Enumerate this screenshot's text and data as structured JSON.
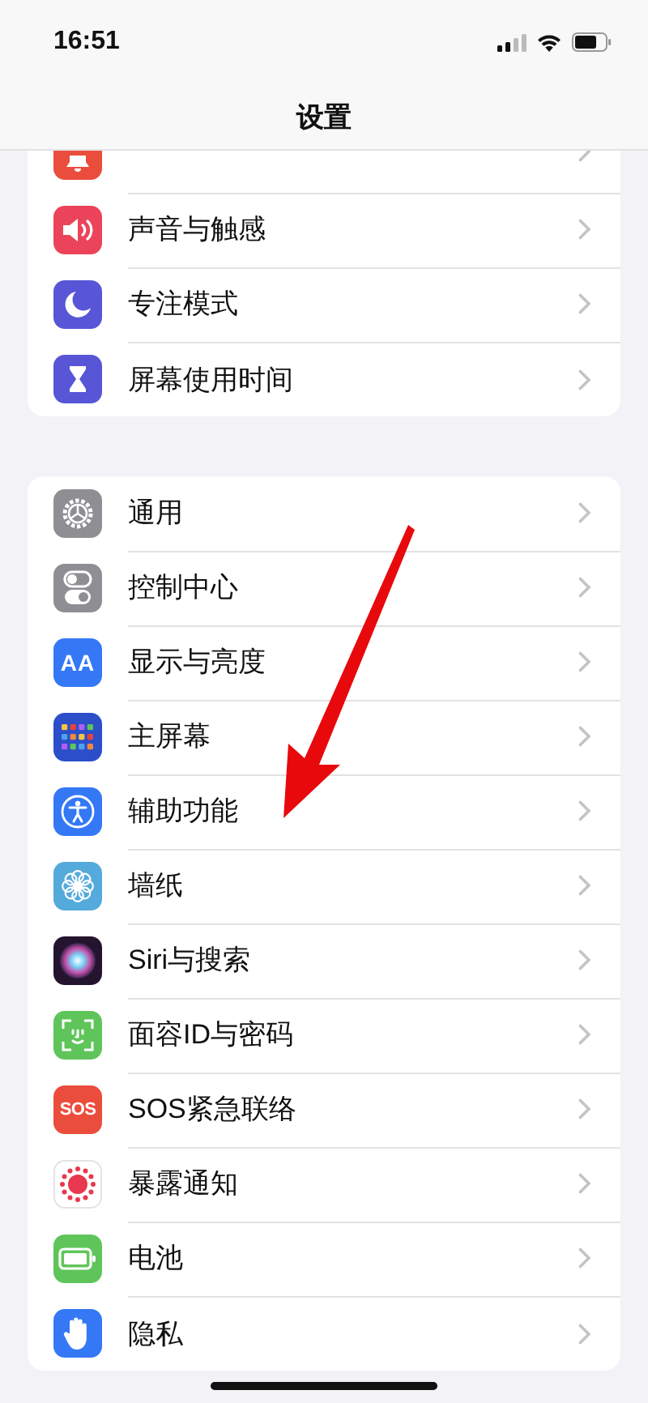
{
  "status_bar": {
    "time": "16:51"
  },
  "nav": {
    "title": "设置"
  },
  "groups": [
    {
      "items": [
        {
          "kind": "bell",
          "color": "#eb4d3d"
        },
        {
          "label": "声音与触感",
          "kind": "speaker",
          "color": "#eb445a"
        },
        {
          "label": "专注模式",
          "kind": "moon",
          "color": "#5856d6"
        },
        {
          "label": "屏幕使用时间",
          "kind": "hourglass",
          "color": "#5856d6"
        }
      ]
    },
    {
      "items": [
        {
          "label": "通用",
          "kind": "gear",
          "color": "#8e8e93"
        },
        {
          "label": "控制中心",
          "kind": "toggles",
          "color": "#8e8e93"
        },
        {
          "label": "显示与亮度",
          "kind": "text",
          "icon_text": "AA",
          "color": "#3478f6"
        },
        {
          "label": "主屏幕",
          "kind": "grid",
          "color": "#2c4ec9"
        },
        {
          "label": "辅助功能",
          "kind": "accessibility",
          "color": "#3478f6"
        },
        {
          "label": "墙纸",
          "kind": "flower",
          "color": "#54aadb"
        },
        {
          "label": "Siri与搜索",
          "kind": "orb",
          "color": "#24142e"
        },
        {
          "label": "面容ID与密码",
          "kind": "face",
          "color": "#5fc55a"
        },
        {
          "label": "SOS紧急联络",
          "kind": "text",
          "icon_text": "SOS",
          "color": "#eb4d3d"
        },
        {
          "label": "暴露通知",
          "kind": "dots",
          "color": "#ffffff"
        },
        {
          "label": "电池",
          "kind": "battery",
          "color": "#5fc55a"
        },
        {
          "label": "隐私",
          "kind": "hand",
          "color": "#3478f6"
        }
      ]
    }
  ]
}
